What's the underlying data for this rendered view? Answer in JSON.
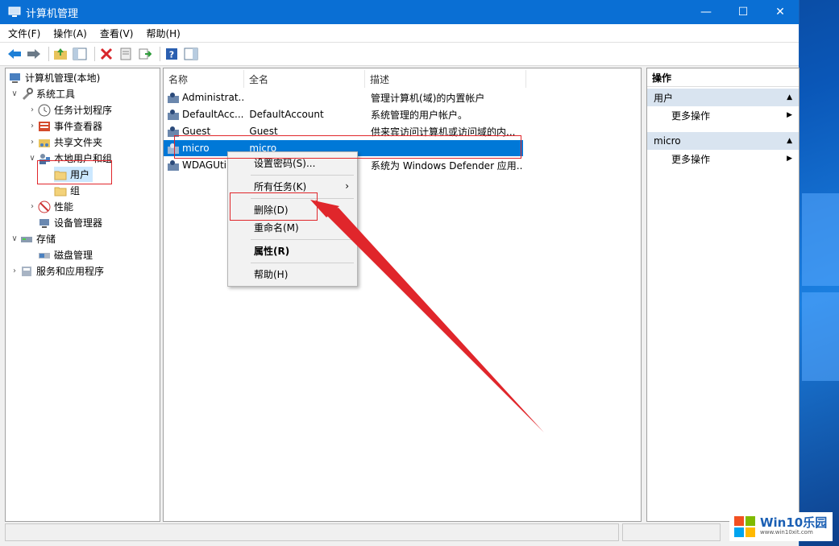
{
  "window": {
    "title": "计算机管理",
    "controls": [
      "—",
      "☐",
      "✕"
    ]
  },
  "menu": [
    "文件(F)",
    "操作(A)",
    "查看(V)",
    "帮助(H)"
  ],
  "tree": {
    "root": "计算机管理(本地)",
    "system_tools": "系统工具",
    "task_scheduler": "任务计划程序",
    "event_viewer": "事件查看器",
    "shared_folders": "共享文件夹",
    "local_users": "本地用户和组",
    "users": "用户",
    "groups": "组",
    "performance": "性能",
    "device_manager": "设备管理器",
    "storage": "存储",
    "disk_management": "磁盘管理",
    "services_apps": "服务和应用程序"
  },
  "list": {
    "columns": [
      "名称",
      "全名",
      "描述"
    ],
    "rows": [
      {
        "name": "Administrat...",
        "full": "",
        "desc": "管理计算机(域)的内置帐户"
      },
      {
        "name": "DefaultAcc...",
        "full": "DefaultAccount",
        "desc": "系统管理的用户帐户。"
      },
      {
        "name": "Guest",
        "full": "Guest",
        "desc": "供来宾访问计算机或访问域的内..."
      },
      {
        "name": "micro",
        "full": "micro",
        "desc": ""
      },
      {
        "name": "WDAGUti",
        "full": "",
        "desc": "系统为 Windows Defender 应用..."
      }
    ]
  },
  "context_menu": {
    "set_password": "设置密码(S)...",
    "all_tasks": "所有任务(K)",
    "delete": "删除(D)",
    "rename": "重命名(M)",
    "properties": "属性(R)",
    "help": "帮助(H)"
  },
  "actions": {
    "title": "操作",
    "section1": "用户",
    "more1": "更多操作",
    "section2": "micro",
    "more2": "更多操作"
  },
  "watermark": {
    "brand": "Win10乐园",
    "url": "www.win10xit.com"
  },
  "colors": {
    "accent": "#0078d7",
    "title_bar": "#0a6fd4",
    "annotation_red": "#e0262b"
  }
}
